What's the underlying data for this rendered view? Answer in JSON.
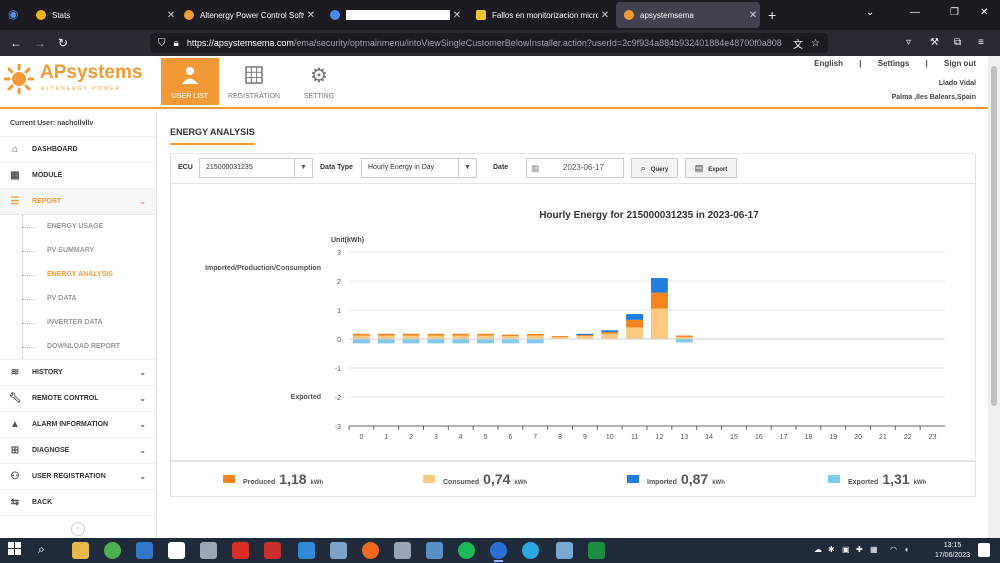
{
  "browser": {
    "tabs": [
      {
        "label": "Stats",
        "icon": "stats-favicon",
        "color": "#f5b400"
      },
      {
        "label": "Altenergy Power Control Softwa",
        "icon": "apsystems-favicon",
        "color": "#f39a36"
      },
      {
        "label": "",
        "icon": "redacted-favicon",
        "color": "#4a8af4"
      },
      {
        "label": "Fallos en monitorizacion micro",
        "icon": "forum-favicon",
        "color": "#f1c232"
      },
      {
        "label": "apsystemsema",
        "icon": "apsystems-favicon",
        "color": "#f39a36"
      }
    ],
    "active_tab": 4,
    "url_domain": "https://apsystemsema.com",
    "url_path": "/ema/security/optmainmenu/intoViewSingleCustomerBelowInstaller.action?userId=2c9f934a884b932401884e48700f0a808"
  },
  "header": {
    "logo_name": "APsystems",
    "logo_sub": "ALTENERGY POWER",
    "nav": [
      {
        "label": "USER LIST",
        "icon": "user-icon",
        "active": true
      },
      {
        "label": "REGISTRATION",
        "icon": "grid-icon",
        "active": false
      },
      {
        "label": "SETTING",
        "icon": "gears-icon",
        "active": false
      }
    ],
    "links": [
      "English",
      "|",
      "Settings",
      "|",
      "Sign out"
    ],
    "user_name": "Llado Vidal",
    "user_location": "Palma ,Iles Balears,Spain"
  },
  "sidebar": {
    "current_user": "Current User: nachollvllv",
    "menu": [
      {
        "label": "DASHBOARD",
        "icon": "home-icon"
      },
      {
        "label": "MODULE",
        "icon": "module-icon"
      },
      {
        "label": "REPORT",
        "icon": "report-icon",
        "open": true
      },
      {
        "label": "HISTORY",
        "icon": "database-icon"
      },
      {
        "label": "REMOTE CONTROL",
        "icon": "wrench-icon"
      },
      {
        "label": "ALARM INFORMATION",
        "icon": "warning-icon"
      },
      {
        "label": "DIAGNOSE",
        "icon": "toolbox-icon"
      },
      {
        "label": "USER REGISTRATION",
        "icon": "user-plus-icon"
      },
      {
        "label": "BACK",
        "icon": "back-icon"
      }
    ],
    "report_sub": [
      "ENERGY USAGE",
      "PV SUMMARY",
      "ENERGY ANALYSIS",
      "PV DATA",
      "INVERTER DATA",
      "DOWNLOAD REPORT"
    ],
    "report_active": 2
  },
  "main": {
    "title": "ENERGY ANALYSIS",
    "ecu_label": "ECU",
    "ecu_value": "215000031235",
    "datatype_label": "Data Type",
    "datatype_value": "Hourly Energy in Day",
    "date_label": "Date",
    "date_value": "2023-06-17",
    "query_label": "Query",
    "export_label": "Export"
  },
  "chart_data": {
    "type": "bar",
    "title": "Hourly Energy for 215000031235 in 2023-06-17",
    "unit_label": "Unit(kWh)",
    "upper_label": "Imported/Production/Consumption",
    "lower_label": "Exported",
    "ylim": [
      -3,
      3
    ],
    "yticks": [
      3,
      2,
      1,
      0,
      -1,
      -2,
      -3
    ],
    "categories": [
      "0",
      "1",
      "2",
      "3",
      "4",
      "5",
      "6",
      "7",
      "8",
      "9",
      "10",
      "11",
      "12",
      "13",
      "14",
      "15",
      "16",
      "17",
      "18",
      "19",
      "20",
      "21",
      "22",
      "23"
    ],
    "series": [
      {
        "name": "Consumed",
        "color": "#fbc97f",
        "values": [
          0.12,
          0.12,
          0.12,
          0.12,
          0.12,
          0.12,
          0.1,
          0.12,
          0.06,
          0.1,
          0.18,
          0.4,
          1.05,
          0.07,
          0,
          0,
          0,
          0,
          0,
          0,
          0,
          0,
          0,
          0
        ]
      },
      {
        "name": "Produced",
        "color": "#f4841f",
        "values": [
          0.06,
          0.06,
          0.06,
          0.06,
          0.06,
          0.06,
          0.05,
          0.05,
          0.04,
          0.04,
          0.06,
          0.26,
          0.55,
          0.05,
          0,
          0,
          0,
          0,
          0,
          0,
          0,
          0,
          0,
          0
        ]
      },
      {
        "name": "Imported",
        "color": "#1f7de0",
        "values": [
          0,
          0,
          0,
          0,
          0,
          0,
          0,
          0,
          0,
          0.04,
          0.06,
          0.2,
          0.5,
          0,
          0,
          0,
          0,
          0,
          0,
          0,
          0,
          0,
          0,
          0
        ]
      },
      {
        "name": "Exported",
        "color": "#7fc9ef",
        "values": [
          -0.15,
          -0.15,
          -0.15,
          -0.15,
          -0.15,
          -0.15,
          -0.15,
          -0.15,
          0,
          0,
          0,
          0,
          0,
          -0.12,
          0,
          0,
          0,
          0,
          0,
          0,
          0,
          0,
          0,
          0
        ]
      }
    ]
  },
  "legend": [
    {
      "name": "Produced",
      "value": "1,18",
      "unit": "kWh",
      "color": "#f4841f"
    },
    {
      "name": "Consumed",
      "value": "0,74",
      "unit": "kWh",
      "color": "#fbc97f"
    },
    {
      "name": "Imported",
      "value": "0,87",
      "unit": "kWh",
      "color": "#1f7de0"
    },
    {
      "name": "Exported",
      "value": "1,31",
      "unit": "kWh",
      "color": "#7fc9ef"
    }
  ],
  "taskbar": {
    "time": "13:15",
    "date": "17/06/2023"
  }
}
